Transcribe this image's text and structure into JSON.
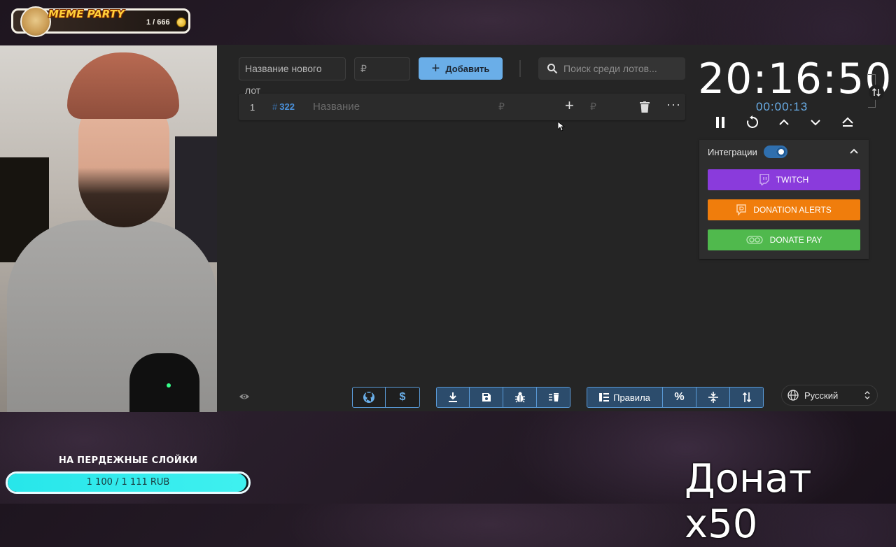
{
  "overlay": {
    "badge_title": "MEME PARTY",
    "badge_count": "1 / 666",
    "goal_title": "НА ПЕРДЕЖНЫЕ СЛОЙКИ",
    "goal_progress": "1 100 / 1 111 RUB",
    "goal_fraction": 0.99,
    "donate_caption": "Донат x50"
  },
  "toolbar": {
    "lot_name_placeholder": "Название нового лот",
    "amount_placeholder": "₽",
    "add_label": "Добавить",
    "search_placeholder": "Поиск среди лотов..."
  },
  "lots": [
    {
      "index": "1",
      "id": "322",
      "title_placeholder": "Название",
      "currency": "₽",
      "extra_currency": "₽"
    }
  ],
  "timer": {
    "main": "20:16:50",
    "elapsed": "00:00:13"
  },
  "integrations": {
    "label": "Интеграции",
    "enabled": true,
    "buttons": {
      "twitch": "TWITCH",
      "donation_alerts": "DONATION ALERTS",
      "donate_pay": "DONATE PAY"
    }
  },
  "footer": {
    "rules_label": "Правила",
    "language": "Русский"
  },
  "colors": {
    "accent": "#6aaee8",
    "twitch": "#8a3bdc",
    "donation_alerts": "#f07d0c",
    "donate_pay": "#50b94d",
    "goal_fill": "#27e6ea"
  },
  "icons": {
    "github": "github-icon",
    "donate": "dollar-icon",
    "download": "download-icon",
    "save": "save-icon",
    "bug": "bug-icon",
    "clear": "clear-list-icon",
    "rules": "rules-icon",
    "percent": "percent-icon",
    "split": "split-icon",
    "sort": "sort-icon"
  }
}
